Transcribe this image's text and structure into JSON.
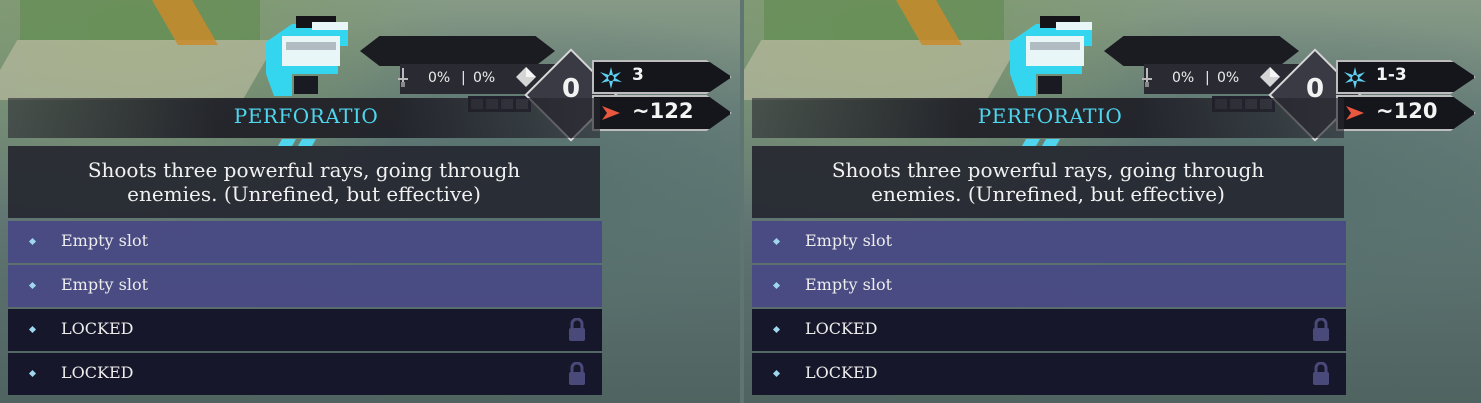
{
  "panels": [
    {
      "weapon_name": "PERFORATIO",
      "crit_chance": "0%",
      "crit_damage": "0%",
      "level": "0",
      "projectiles": "3",
      "damage": "~122",
      "description": "Shoots three powerful rays, going through enemies. (Unrefined, but effective)",
      "slots": [
        {
          "label": "Empty slot",
          "state": "empty"
        },
        {
          "label": "Empty slot",
          "state": "empty"
        },
        {
          "label": "LOCKED",
          "state": "locked"
        },
        {
          "label": "LOCKED",
          "state": "locked"
        }
      ]
    },
    {
      "weapon_name": "PERFORATIO",
      "crit_chance": "0%",
      "crit_damage": "0%",
      "level": "0",
      "projectiles": "1-3",
      "damage": "~120",
      "description": "Shoots three powerful rays, going through enemies. (Unrefined, but effective)",
      "slots": [
        {
          "label": "Empty slot",
          "state": "empty"
        },
        {
          "label": "Empty slot",
          "state": "empty"
        },
        {
          "label": "LOCKED",
          "state": "locked"
        },
        {
          "label": "LOCKED",
          "state": "locked"
        }
      ]
    }
  ],
  "stat_separator": "|",
  "icons": {
    "weapon": "pixel-gun-icon",
    "crit": "dagger-icon",
    "gem": "gem-icon",
    "projectiles": "burst-icon",
    "damage": "arrow-icon",
    "lock": "lock-icon"
  },
  "colors": {
    "title": "#4fd6ee",
    "empty_slot": "#484884",
    "locked_slot": "#141428",
    "damage_arrow": "#e9573f",
    "burst": "#5fd0f0"
  }
}
